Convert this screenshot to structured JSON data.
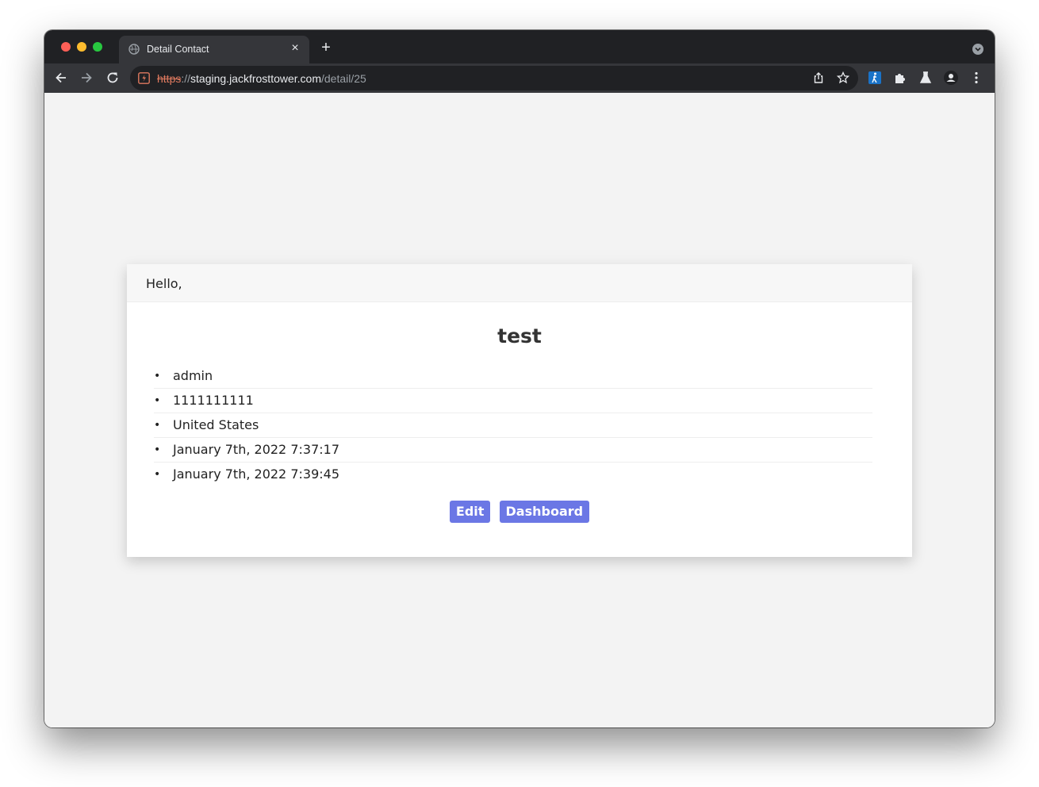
{
  "browser": {
    "tab_title": "Detail Contact",
    "tab_close": "×",
    "new_tab": "+",
    "url": {
      "scheme": "https",
      "separator": "://",
      "host": "staging.jackfrosttower.com",
      "path": "/detail/25"
    },
    "icons": {
      "tab": "globe-icon",
      "back": "back-arrow-icon",
      "forward": "forward-arrow-icon",
      "reload": "reload-icon",
      "security": "not-secure-warning-icon",
      "share": "share-icon",
      "bookmark": "star-icon",
      "extension1": "walking-person-extension-icon",
      "extensions": "puzzle-icon",
      "labs": "flask-icon",
      "profile": "profile-icon",
      "menu": "kebab-menu-icon",
      "tab_search": "tab-search-icon"
    }
  },
  "card": {
    "header": "Hello,",
    "title": "test",
    "bullet": "•",
    "items": [
      "admin",
      "1111111111",
      "United States",
      "January 7th, 2022 7:37:17",
      "January 7th, 2022 7:39:45"
    ],
    "buttons": {
      "edit": "Edit",
      "dashboard": "Dashboard"
    }
  },
  "colors": {
    "button": "#6b77e5",
    "chrome_dark": "#202124",
    "chrome_toolbar": "#35363a",
    "page_background": "#f3f3f3",
    "insecure_scheme": "#e07a5f"
  }
}
